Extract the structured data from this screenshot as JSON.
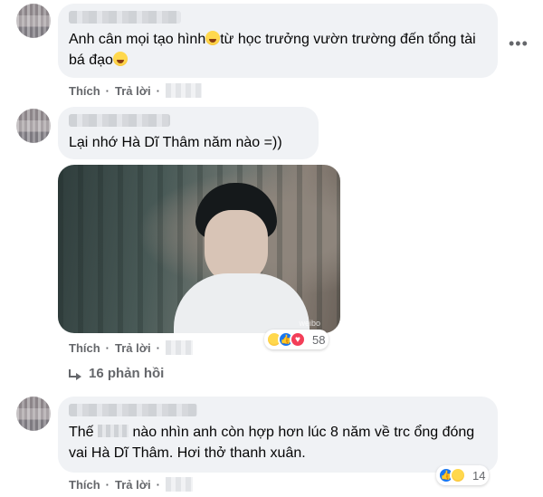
{
  "comments": [
    {
      "text_before": "Anh cân mọi tạo hình",
      "text_middle": "từ học trưởng vườn trường đến tổng tài bá đạo",
      "actions": {
        "like": "Thích",
        "reply": "Trả lời"
      },
      "more_icon": "more-horizontal-icon"
    },
    {
      "text": "Lại nhớ Hà Dĩ Thâm năm nào =))",
      "actions": {
        "like": "Thích",
        "reply": "Trả lời"
      },
      "photo_watermark": "weibo",
      "reactions": {
        "icons": [
          "haha",
          "like",
          "love"
        ],
        "count": "58"
      }
    },
    {
      "text_before": "Thế",
      "text_after": "nào nhìn anh còn hợp hơn lúc 8 năm về trc ổng đóng vai Hà Dĩ Thâm. Hơi thở thanh xuân.",
      "actions": {
        "like": "Thích",
        "reply": "Trả lời"
      },
      "reactions": {
        "icons": [
          "like",
          "haha"
        ],
        "count": "14"
      }
    }
  ],
  "replies_link": "16 phản hồi",
  "colors": {
    "bubble": "#f0f2f5",
    "meta": "#65676b",
    "like_blue": "#1877f2",
    "love_red": "#f33e58"
  }
}
